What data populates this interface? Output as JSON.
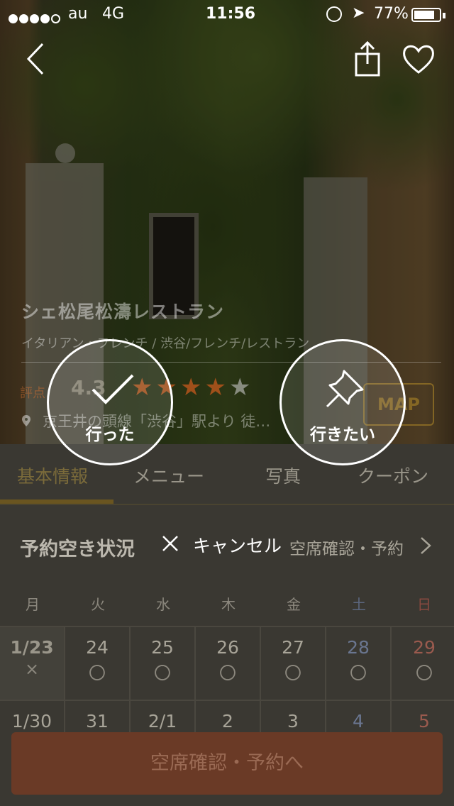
{
  "status_bar": {
    "carrier": "au",
    "network": "4G",
    "time": "11:56",
    "battery": "77%",
    "battery_level": 0.77,
    "signal_bars": 4
  },
  "nav": {
    "back_icon": "chevron-left-icon",
    "share_icon": "share-icon",
    "like_icon": "heart-icon"
  },
  "restaurant": {
    "name": "シェ松尾松濤レストラン",
    "genre": "イタリアン・フレンチ / 渋谷/フレンチ/レストラン",
    "rating_label": "評点",
    "rating": "4.3",
    "stars_filled": 4,
    "stars_total": 5,
    "map_label": "MAP",
    "station": "京王井の頭線「渋谷」駅より 徒…"
  },
  "actions": {
    "went_label": "行った",
    "want_label": "行きたい",
    "cancel_label": "キャンセル"
  },
  "tabs": [
    {
      "label": "基本情報",
      "active": true
    },
    {
      "label": "メニュー",
      "active": false
    },
    {
      "label": "写真",
      "active": false
    },
    {
      "label": "クーポン",
      "active": false
    }
  ],
  "availability": {
    "title": "予約空き状況",
    "link": "空席確認・予約"
  },
  "calendar": {
    "weekdays": [
      "月",
      "火",
      "水",
      "木",
      "金",
      "土",
      "日"
    ],
    "row1": {
      "dates": [
        "1/23",
        "24",
        "25",
        "26",
        "27",
        "28",
        "29"
      ],
      "marks": [
        "×",
        "〇",
        "〇",
        "〇",
        "〇",
        "〇",
        "〇"
      ]
    },
    "row2": {
      "dates": [
        "1/30",
        "31",
        "2/1",
        "2",
        "3",
        "4",
        "5"
      ]
    }
  },
  "cta_label": "空席確認・予約へ",
  "colors": {
    "accent_gold": "#6a5520",
    "cta_red": "#6a3a26",
    "star_orange": "#c85a1e"
  }
}
